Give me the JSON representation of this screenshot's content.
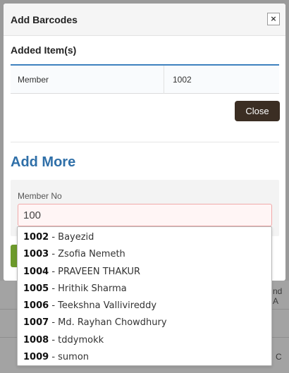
{
  "modal": {
    "title": "Add Barcodes",
    "close_icon": "×"
  },
  "added_items": {
    "title": "Added Item(s)",
    "rows": [
      {
        "type": "Member",
        "value": "1002"
      }
    ]
  },
  "close_button": "Close",
  "add_more": {
    "title": "Add More",
    "member_label": "Member No",
    "member_value": "100"
  },
  "suggestions": [
    {
      "id": "1002",
      "name": "Bayezid"
    },
    {
      "id": "1003",
      "name": "Zsofia Nemeth"
    },
    {
      "id": "1004",
      "name": "PRAVEEN THAKUR"
    },
    {
      "id": "1005",
      "name": "Hrithik Sharma"
    },
    {
      "id": "1006",
      "name": "Teekshna Vallivireddy"
    },
    {
      "id": "1007",
      "name": "Md. Rayhan Chowdhury"
    },
    {
      "id": "1008",
      "name": "tddymokk"
    },
    {
      "id": "1009",
      "name": "sumon"
    }
  ],
  "suggestion_separator": " - ",
  "background": {
    "fragment_1": "nd A",
    "fragment_2": "C"
  }
}
